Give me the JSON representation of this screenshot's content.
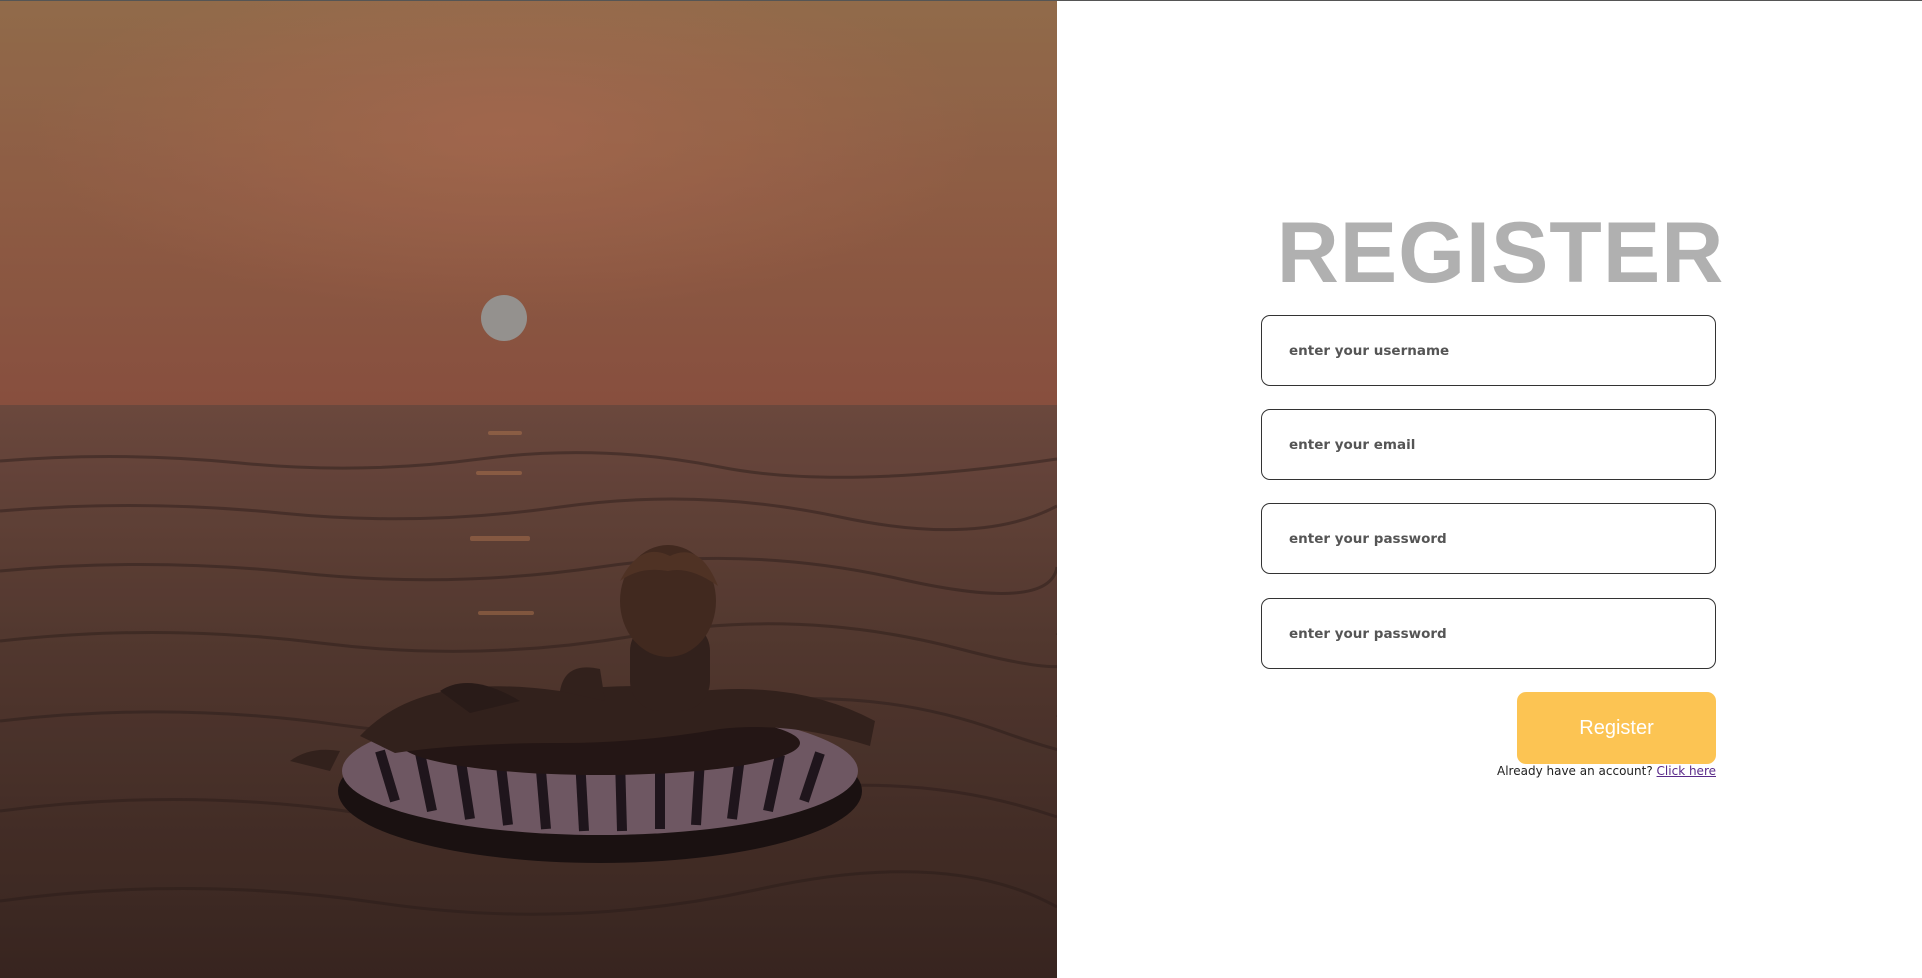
{
  "form": {
    "title": "REGISTER",
    "username_placeholder": "enter your username",
    "email_placeholder": "enter your email",
    "password_placeholder": "enter your password",
    "confirm_password_placeholder": "enter your password",
    "submit_label": "Register",
    "login_prompt": "Already have an account?",
    "login_link": "Click here"
  },
  "colors": {
    "button": "#fcc453",
    "title": "#b0b0b0"
  },
  "hero": {
    "image_subject": "person-in-swim-ring-at-sunset-icon"
  }
}
